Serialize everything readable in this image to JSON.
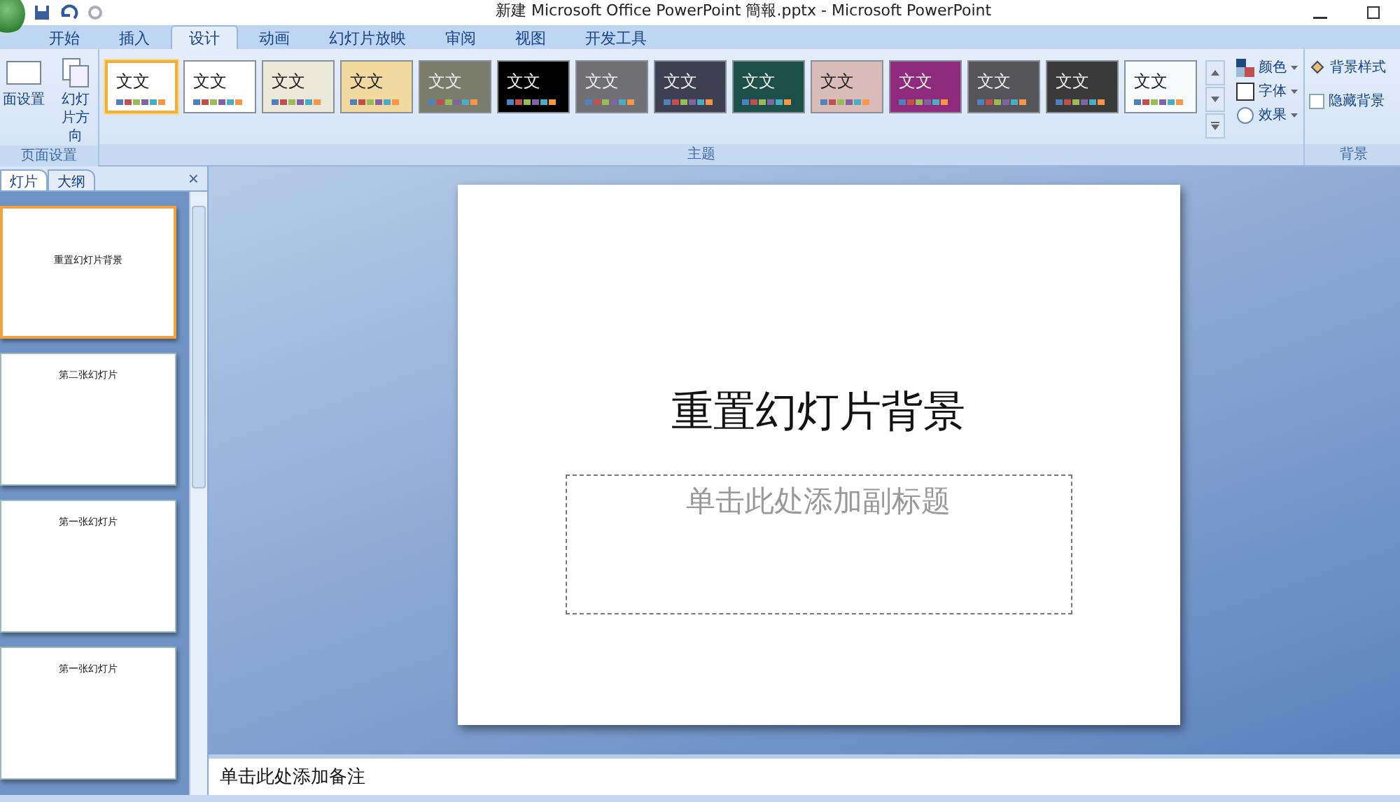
{
  "window": {
    "title": "新建 Microsoft Office PowerPoint 簡報.pptx - Microsoft PowerPoint"
  },
  "tabs": [
    {
      "label": "开始",
      "selected": false
    },
    {
      "label": "插入",
      "selected": false
    },
    {
      "label": "设计",
      "selected": true
    },
    {
      "label": "动画",
      "selected": false
    },
    {
      "label": "幻灯片放映",
      "selected": false
    },
    {
      "label": "审阅",
      "selected": false
    },
    {
      "label": "视图",
      "selected": false
    },
    {
      "label": "开发工具",
      "selected": false
    }
  ],
  "page_setup": {
    "buttons": [
      "面设置",
      "幻灯片方向"
    ],
    "label": "页面设置"
  },
  "themes": {
    "items": [
      {
        "label": "文文",
        "color": "#ffffff",
        "selected": true
      },
      {
        "label": "文文",
        "color": "#ffffff",
        "selected": false
      },
      {
        "label": "文文",
        "color": "#ece8da",
        "selected": false
      },
      {
        "label": "文文",
        "color": "#f1d9a0",
        "selected": false
      },
      {
        "label": "文文",
        "color": "#7b7d6c",
        "selected": false
      },
      {
        "label": "文文",
        "color": "#000000",
        "selected": false
      },
      {
        "label": "文文",
        "color": "#6f6f74",
        "selected": false
      },
      {
        "label": "文文",
        "color": "#3f3f52",
        "selected": false
      },
      {
        "label": "文文",
        "color": "#1c4f48",
        "selected": false
      },
      {
        "label": "文文",
        "color": "#d9bcb8",
        "selected": false
      },
      {
        "label": "文文",
        "color": "#8d2a7c",
        "selected": false
      },
      {
        "label": "文文",
        "color": "#545459",
        "selected": false
      },
      {
        "label": "文文",
        "color": "#3a3a3a",
        "selected": false
      },
      {
        "label": "文文",
        "color": "#f8fbfc",
        "selected": false
      }
    ],
    "options": [
      "颜色",
      "字体",
      "效果"
    ],
    "label": "主题"
  },
  "background": {
    "style_button": "背景样式",
    "hide_graphics": {
      "label": "隐藏背景",
      "checked": false
    },
    "label": "背景"
  },
  "panel": {
    "tabs": [
      {
        "label": "灯片",
        "selected": true
      },
      {
        "label": "大纲",
        "selected": false
      }
    ],
    "close": "×",
    "slides": [
      {
        "title": "重置幻灯片背景",
        "selected": true
      },
      {
        "title": "第二张幻灯片",
        "selected": false
      },
      {
        "title": "第一张幻灯片",
        "selected": false
      },
      {
        "title": "第一张幻灯片",
        "selected": false
      }
    ]
  },
  "slide": {
    "title": "重置幻灯片背景",
    "subtitle_placeholder": "单击此处添加副标题"
  },
  "notes": {
    "placeholder": "单击此处添加备注"
  }
}
